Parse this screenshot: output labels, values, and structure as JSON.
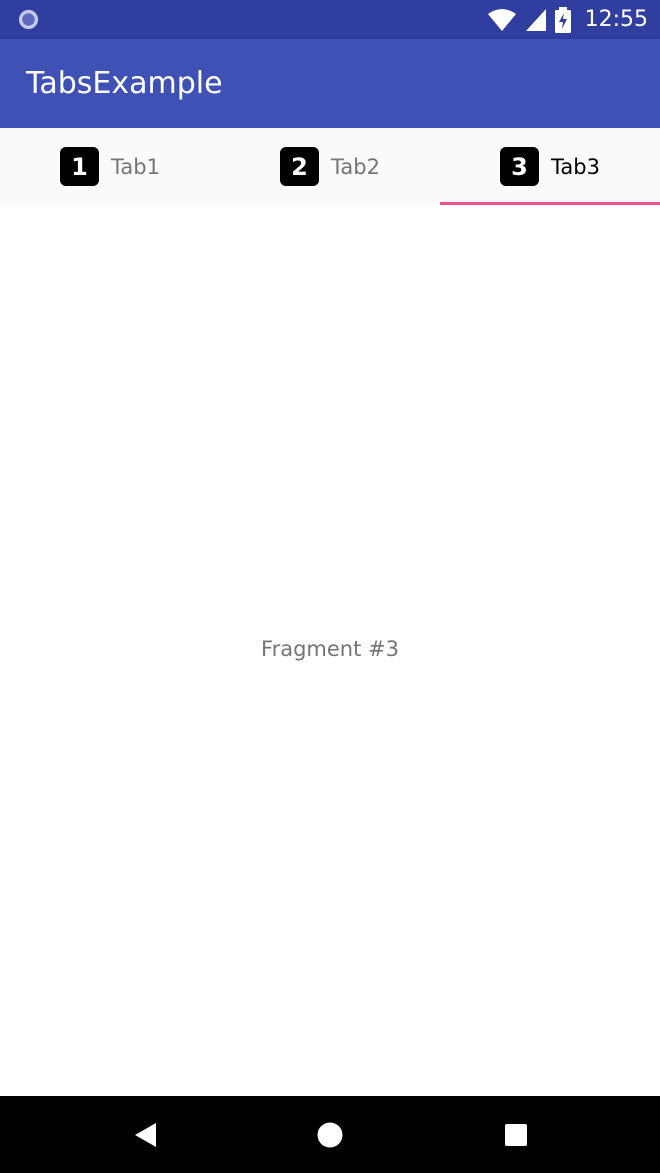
{
  "status_bar": {
    "time": "12:55",
    "icons": [
      "circle-icon",
      "wifi-icon",
      "signal-icon",
      "battery-charging-icon"
    ],
    "color": "#303f9f"
  },
  "app_bar": {
    "title": "TabsExample",
    "color": "#3f51b5"
  },
  "tabs": [
    {
      "icon_text": "1",
      "label": "Tab1",
      "selected": false
    },
    {
      "icon_text": "2",
      "label": "Tab2",
      "selected": false
    },
    {
      "icon_text": "3",
      "label": "Tab3",
      "selected": true
    }
  ],
  "tab_indicator_color": "#e8538a",
  "content": {
    "text": "Fragment #3"
  },
  "nav_bar": {
    "icons": [
      "back-icon",
      "home-icon",
      "recents-icon"
    ]
  }
}
